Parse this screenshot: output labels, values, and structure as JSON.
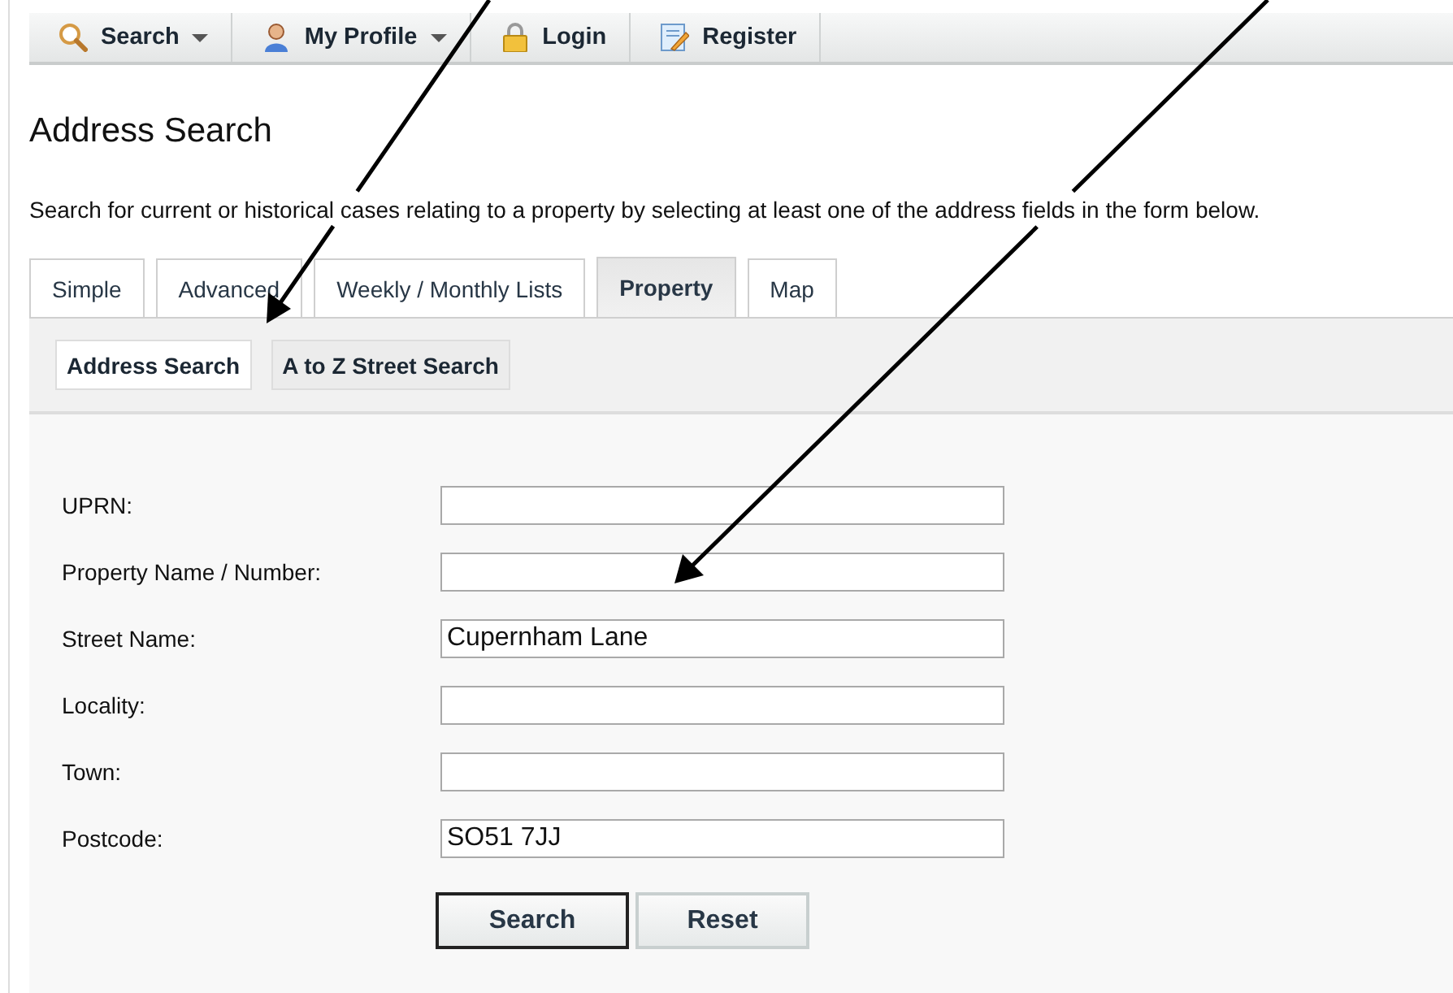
{
  "toolbar": [
    {
      "kind": "search",
      "label": "Search",
      "dropdown": true
    },
    {
      "kind": "profile",
      "label": "My Profile",
      "dropdown": true
    },
    {
      "kind": "lock",
      "label": "Login",
      "dropdown": false
    },
    {
      "kind": "register",
      "label": "Register",
      "dropdown": false
    }
  ],
  "title": "Address Search",
  "description": "Search for current or historical cases relating to a property by selecting at least one of the address fields in the form below.",
  "tabs": [
    {
      "label": "Simple",
      "selected": false
    },
    {
      "label": "Advanced",
      "selected": false
    },
    {
      "label": "Weekly / Monthly Lists",
      "selected": false
    },
    {
      "label": "Property",
      "selected": true
    },
    {
      "label": "Map",
      "selected": false
    }
  ],
  "subtabs": [
    {
      "label": "Address Search",
      "selected": true
    },
    {
      "label": "A to Z Street Search",
      "selected": false
    }
  ],
  "fields": [
    {
      "label": "UPRN:"
    },
    {
      "label": "Property Name / Number:"
    },
    {
      "label": "Street Name:",
      "value": "Cupernham Lane"
    },
    {
      "label": "Locality:"
    },
    {
      "label": "Town:"
    },
    {
      "label": "Postcode:",
      "value": "SO51 7JJ"
    }
  ],
  "buttons": [
    {
      "label": "Search",
      "default": true
    },
    {
      "label": "Reset",
      "default": false
    }
  ]
}
